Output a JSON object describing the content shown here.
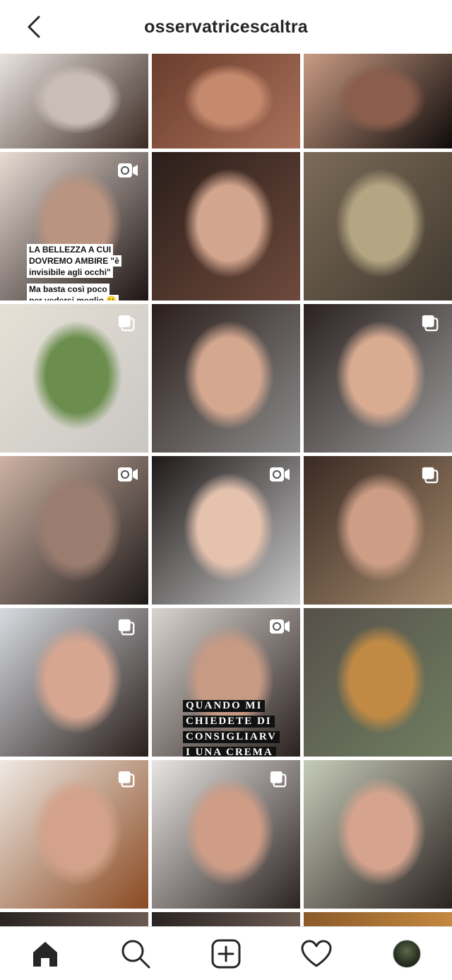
{
  "header": {
    "username": "osservatricescaltra",
    "back_icon": "chevron-left-icon"
  },
  "grid": {
    "posts": [
      {
        "id": "p1",
        "type": "photo",
        "colors": [
          "#e9e3df",
          "#c9bdb7",
          "#3c2b24"
        ]
      },
      {
        "id": "p2",
        "type": "photo",
        "colors": [
          "#6b3d2c",
          "#c58a6e",
          "#a8705a"
        ]
      },
      {
        "id": "p3",
        "type": "photo",
        "colors": [
          "#c99b84",
          "#8a5d4c",
          "#0f0b0a"
        ]
      },
      {
        "id": "p4",
        "type": "video",
        "colors": [
          "#e8dcd4",
          "#b99480",
          "#1e1514"
        ]
      },
      {
        "id": "p5",
        "type": "photo",
        "colors": [
          "#2b1e1a",
          "#d2a58e",
          "#6e4a3c"
        ]
      },
      {
        "id": "p6",
        "type": "photo",
        "colors": [
          "#7b6a57",
          "#b4a682",
          "#413a30"
        ]
      },
      {
        "id": "p7",
        "type": "carousel",
        "colors": [
          "#e6e1d6",
          "#6b8e4e",
          "#c9c6c3"
        ]
      },
      {
        "id": "p8",
        "type": "photo",
        "colors": [
          "#2a1e1a",
          "#d4a78f",
          "#8c8c8c"
        ]
      },
      {
        "id": "p9",
        "type": "carousel",
        "colors": [
          "#2b2220",
          "#d9ab91",
          "#9a9a9a"
        ]
      },
      {
        "id": "p10",
        "type": "video",
        "colors": [
          "#cdb2a4",
          "#9b7d70",
          "#1f1a19"
        ]
      },
      {
        "id": "p11",
        "type": "video",
        "colors": [
          "#1e1918",
          "#e5c2ae",
          "#c9c9c9"
        ]
      },
      {
        "id": "p12",
        "type": "carousel",
        "colors": [
          "#3a2a24",
          "#cd9d86",
          "#a58a6c"
        ]
      },
      {
        "id": "p13",
        "type": "carousel",
        "colors": [
          "#d7dbe0",
          "#d6a690",
          "#2a1f1c"
        ]
      },
      {
        "id": "p14",
        "type": "video",
        "colors": [
          "#d9d4cf",
          "#c79a84",
          "#2b2220"
        ]
      },
      {
        "id": "p15",
        "type": "photo",
        "colors": [
          "#56504a",
          "#c08a45",
          "#6f7d60"
        ]
      },
      {
        "id": "p16",
        "type": "carousel",
        "colors": [
          "#efe9e4",
          "#d4a28a",
          "#8a4a22"
        ]
      },
      {
        "id": "p17",
        "type": "carousel",
        "colors": [
          "#e8e5e2",
          "#cf9d86",
          "#2c2422"
        ]
      },
      {
        "id": "p18",
        "type": "photo",
        "colors": [
          "#c6cbb8",
          "#d6a48e",
          "#2b2321"
        ]
      }
    ],
    "overlays": {
      "p4_text": [
        "LA BELLEZZA A CUI",
        "DOVREMO AMBIRE \"è",
        "invisibile agli occhi\"",
        "Ma basta così poco",
        "per vedersi meglio 🙂"
      ],
      "p14_text": [
        "QUANDO MI",
        "CHIEDETE DI",
        "CONSIGLIARV",
        "I UNA CREMA"
      ]
    }
  },
  "tabbar": {
    "items": [
      {
        "name": "tab-home",
        "icon": "home-icon"
      },
      {
        "name": "tab-search",
        "icon": "search-icon"
      },
      {
        "name": "tab-new-post",
        "icon": "add-post-icon"
      },
      {
        "name": "tab-activity",
        "icon": "heart-icon"
      },
      {
        "name": "tab-profile",
        "icon": "profile-avatar"
      }
    ]
  }
}
